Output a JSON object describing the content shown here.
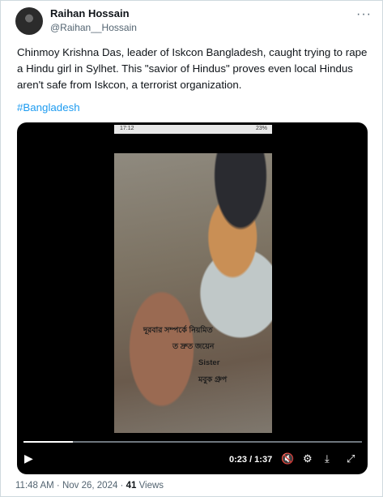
{
  "author": {
    "name": "Raihan Hossain",
    "handle": "@Raihan__Hossain"
  },
  "more_icon": "more-horizontal-icon",
  "tweet": {
    "text": "Chinmoy Krishna Das, leader of Iskcon Bangladesh, caught trying to rape a Hindu girl in Sylhet. This \"savior of Hindus\" proves even local Hindus aren't safe from Iskcon, a terrorist organization.",
    "hashtag": "#Bangladesh"
  },
  "video": {
    "phone_time": "17:12",
    "phone_status": "23%",
    "overlay_lines": [
      "দূরবার সম্পর্কে নিয়মিত",
      "ত দ্রুত জয়েন",
      "Sister",
      "মবুক গ্রুপ"
    ],
    "progress_fraction": 0.147,
    "time_label": "0:23 / 1:37",
    "icons": [
      "play-icon",
      "volume-mute-icon",
      "settings-icon",
      "minimize-icon",
      "fullscreen-icon"
    ]
  },
  "footer": {
    "timestamp": "11:48 AM · Nov 26, 2024 · ",
    "views_count": "41",
    "views_label": " Views"
  }
}
